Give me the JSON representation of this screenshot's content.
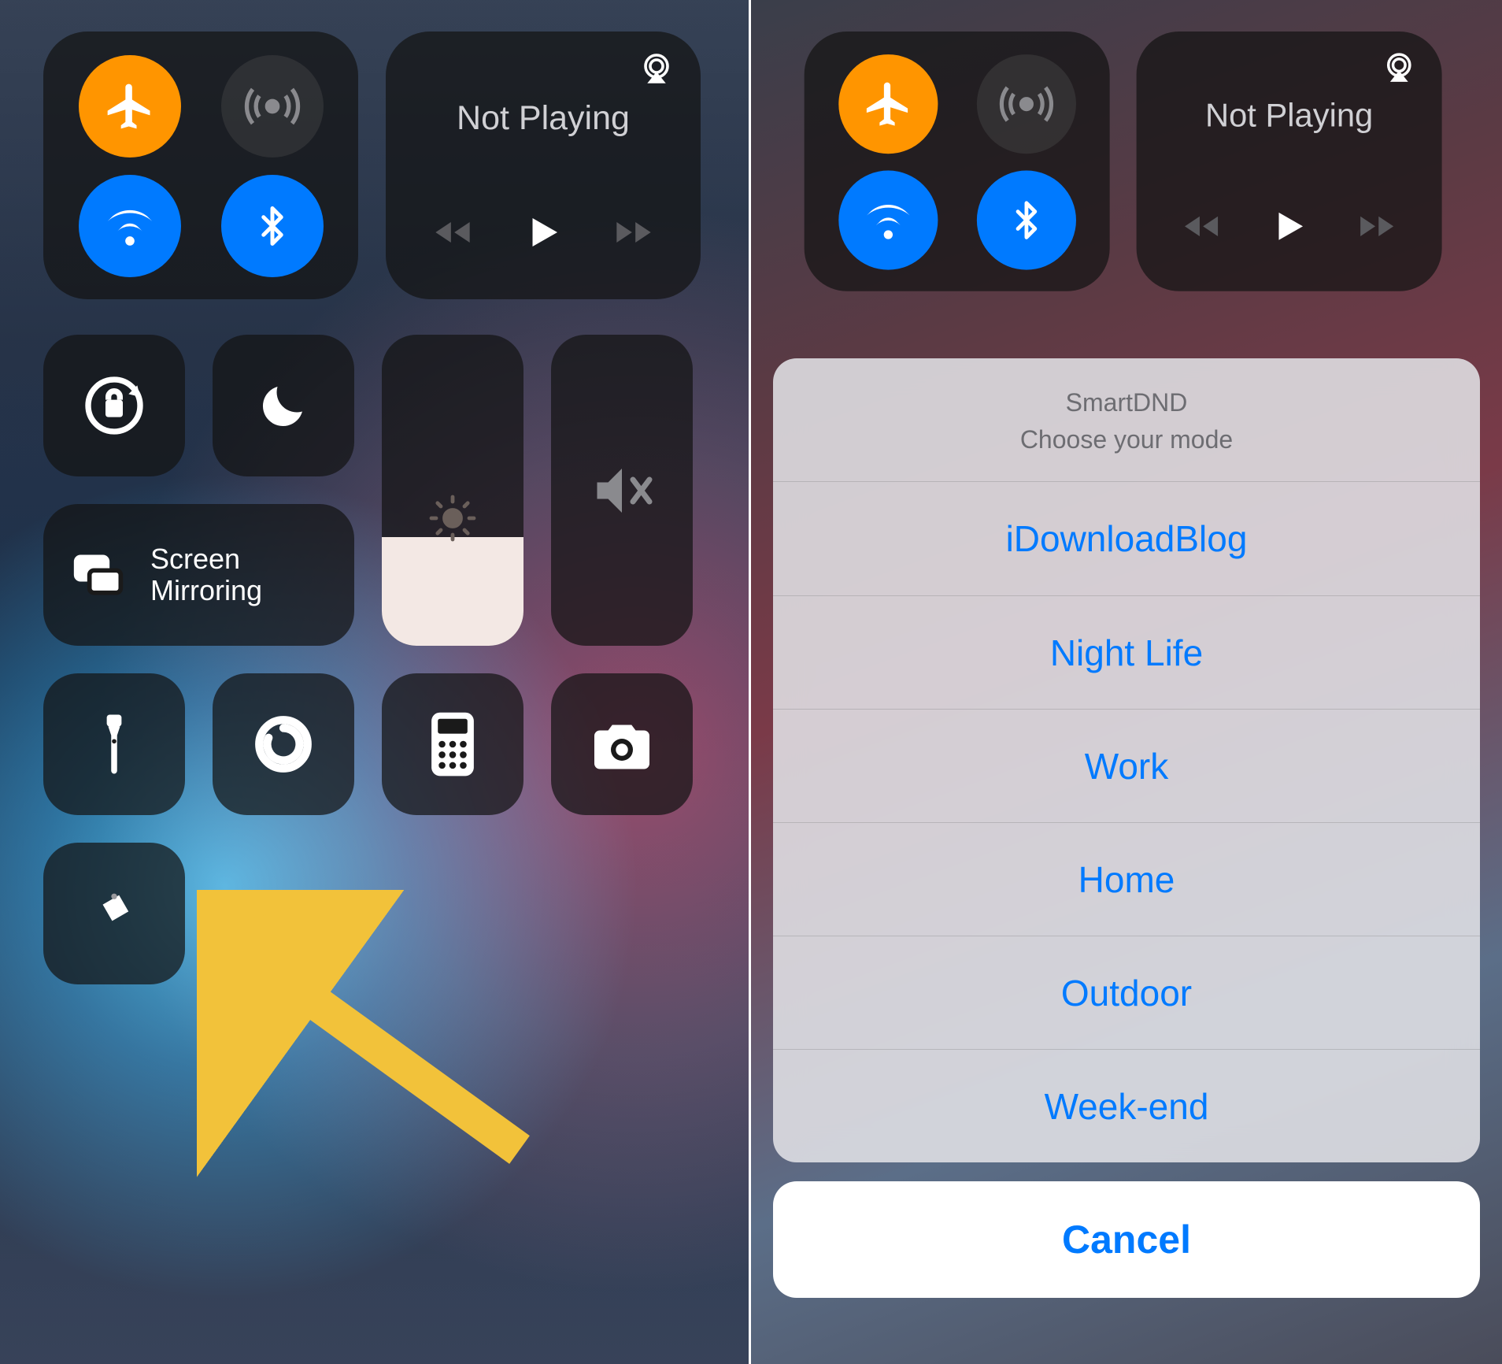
{
  "left": {
    "not_playing": "Not Playing",
    "screen_mirroring": "Screen\nMirroring"
  },
  "right": {
    "not_playing": "Not Playing",
    "sheet": {
      "title": "SmartDND",
      "subtitle": "Choose your mode",
      "items": [
        "iDownloadBlog",
        "Night Life",
        "Work",
        "Home",
        "Outdoor",
        "Week-end"
      ],
      "cancel": "Cancel"
    }
  },
  "colors": {
    "accent_blue": "#007aff",
    "accent_orange": "#ff9500"
  }
}
